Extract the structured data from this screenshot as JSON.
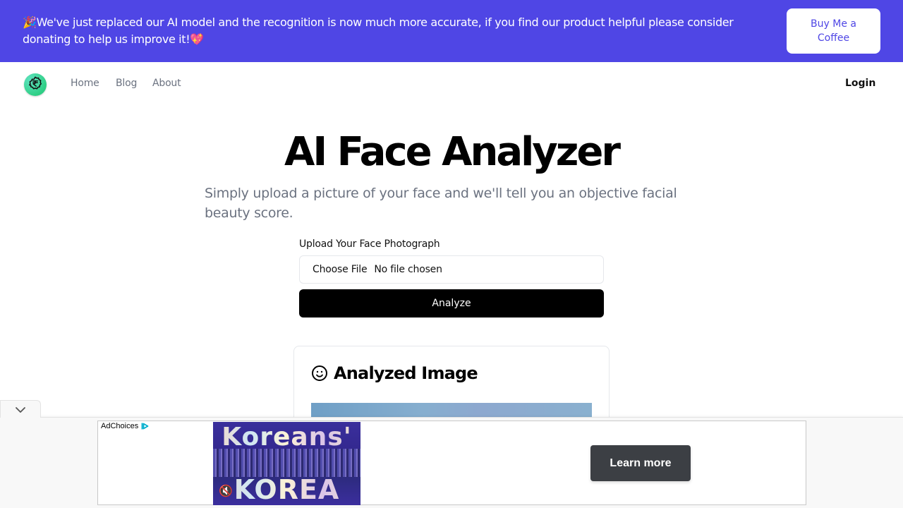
{
  "banner": {
    "message": "🎉We've just replaced our AI model and the recognition is now much more accurate, if you find our product helpful please consider donating to help us improve it!💖",
    "donate_button": "Buy Me a Coffee",
    "background_color": "#4f46e5"
  },
  "nav": {
    "logo_icon": "rupee-badge-icon",
    "links": [
      {
        "label": "Home"
      },
      {
        "label": "Blog"
      },
      {
        "label": "About"
      }
    ],
    "login": "Login"
  },
  "hero": {
    "title": "AI Face Analyzer",
    "subtitle": "Simply upload a picture of your face and we'll tell you an objective facial beauty score."
  },
  "upload": {
    "label": "Upload Your Face Photograph",
    "choose_button": "Choose File",
    "file_status": "No file chosen",
    "analyze_button": "Analyze"
  },
  "result_card": {
    "icon": "smile-icon",
    "title": "Analyzed Image"
  },
  "ad": {
    "adchoices_label": "AdChoices",
    "video_title_top": "Koreans'",
    "video_title_bottom": "KOREA",
    "cta": "Learn more",
    "collapse_icon": "chevron-down-icon"
  }
}
